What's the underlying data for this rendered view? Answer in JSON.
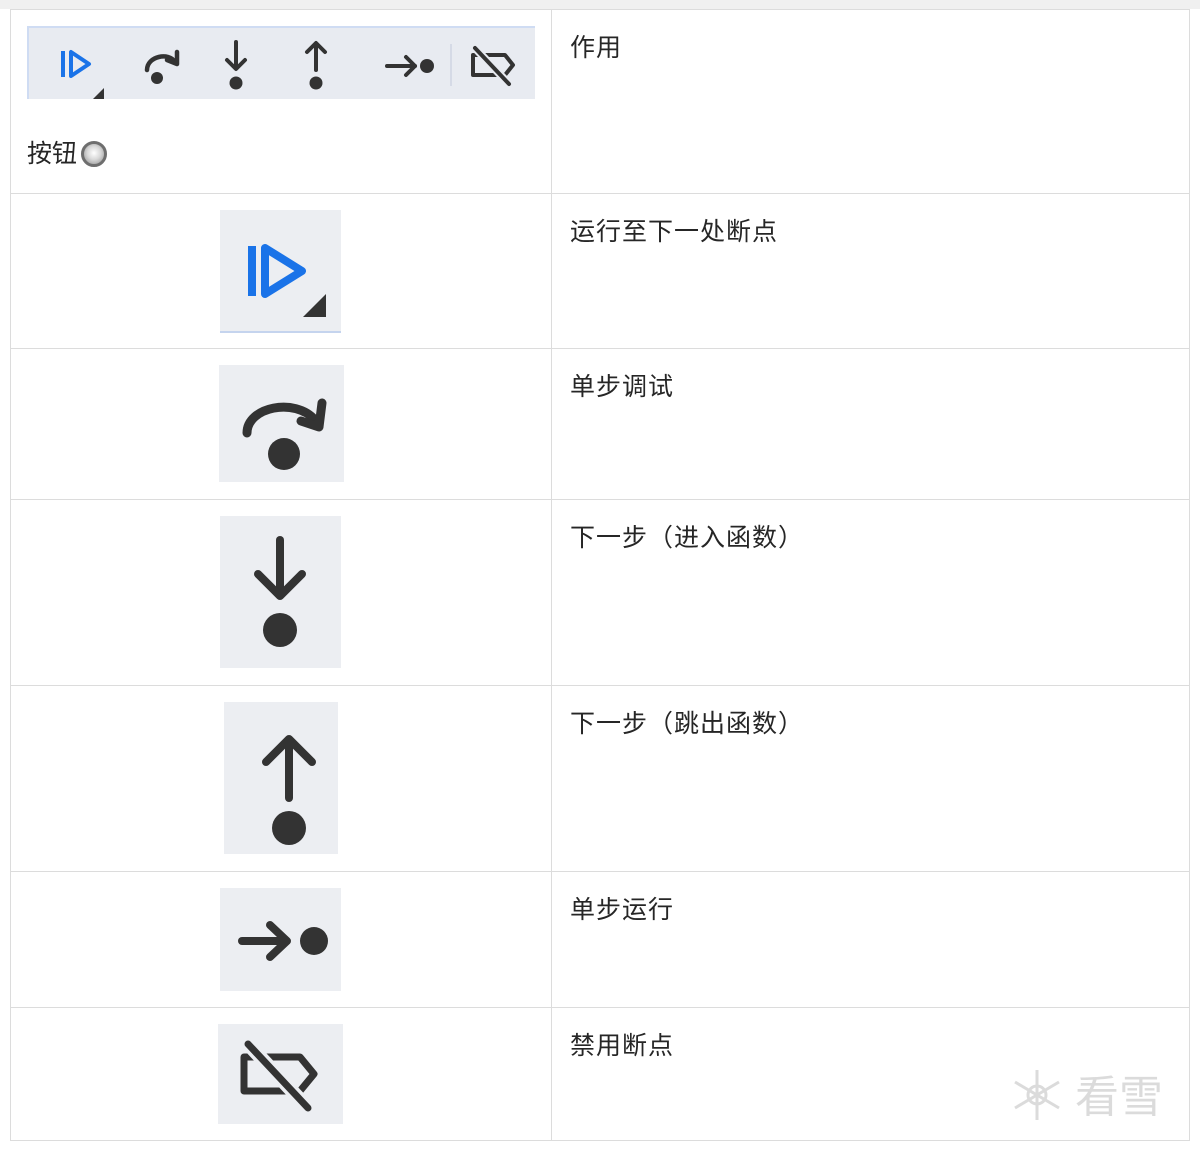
{
  "table": {
    "header": {
      "button_label": "按钮",
      "effect_label": "作用"
    },
    "rows": [
      {
        "icon": "run-to-next-breakpoint-icon",
        "description": "运行至下一处断点"
      },
      {
        "icon": "step-over-icon",
        "description": "单步调试"
      },
      {
        "icon": "step-into-icon",
        "description": "下一步（进入函数）"
      },
      {
        "icon": "step-out-icon",
        "description": "下一步（跳出函数）"
      },
      {
        "icon": "step-icon",
        "description": "单步运行"
      },
      {
        "icon": "deactivate-breakpoints-icon",
        "description": "禁用断点"
      }
    ]
  },
  "colors": {
    "accent_blue": "#1a73e8",
    "icon_gray": "#333333",
    "tile_bg": "#eceef2",
    "toolbar_bg": "#e8ebf1"
  },
  "watermark": {
    "icon": "snowflake-icon",
    "text": "看雪"
  }
}
